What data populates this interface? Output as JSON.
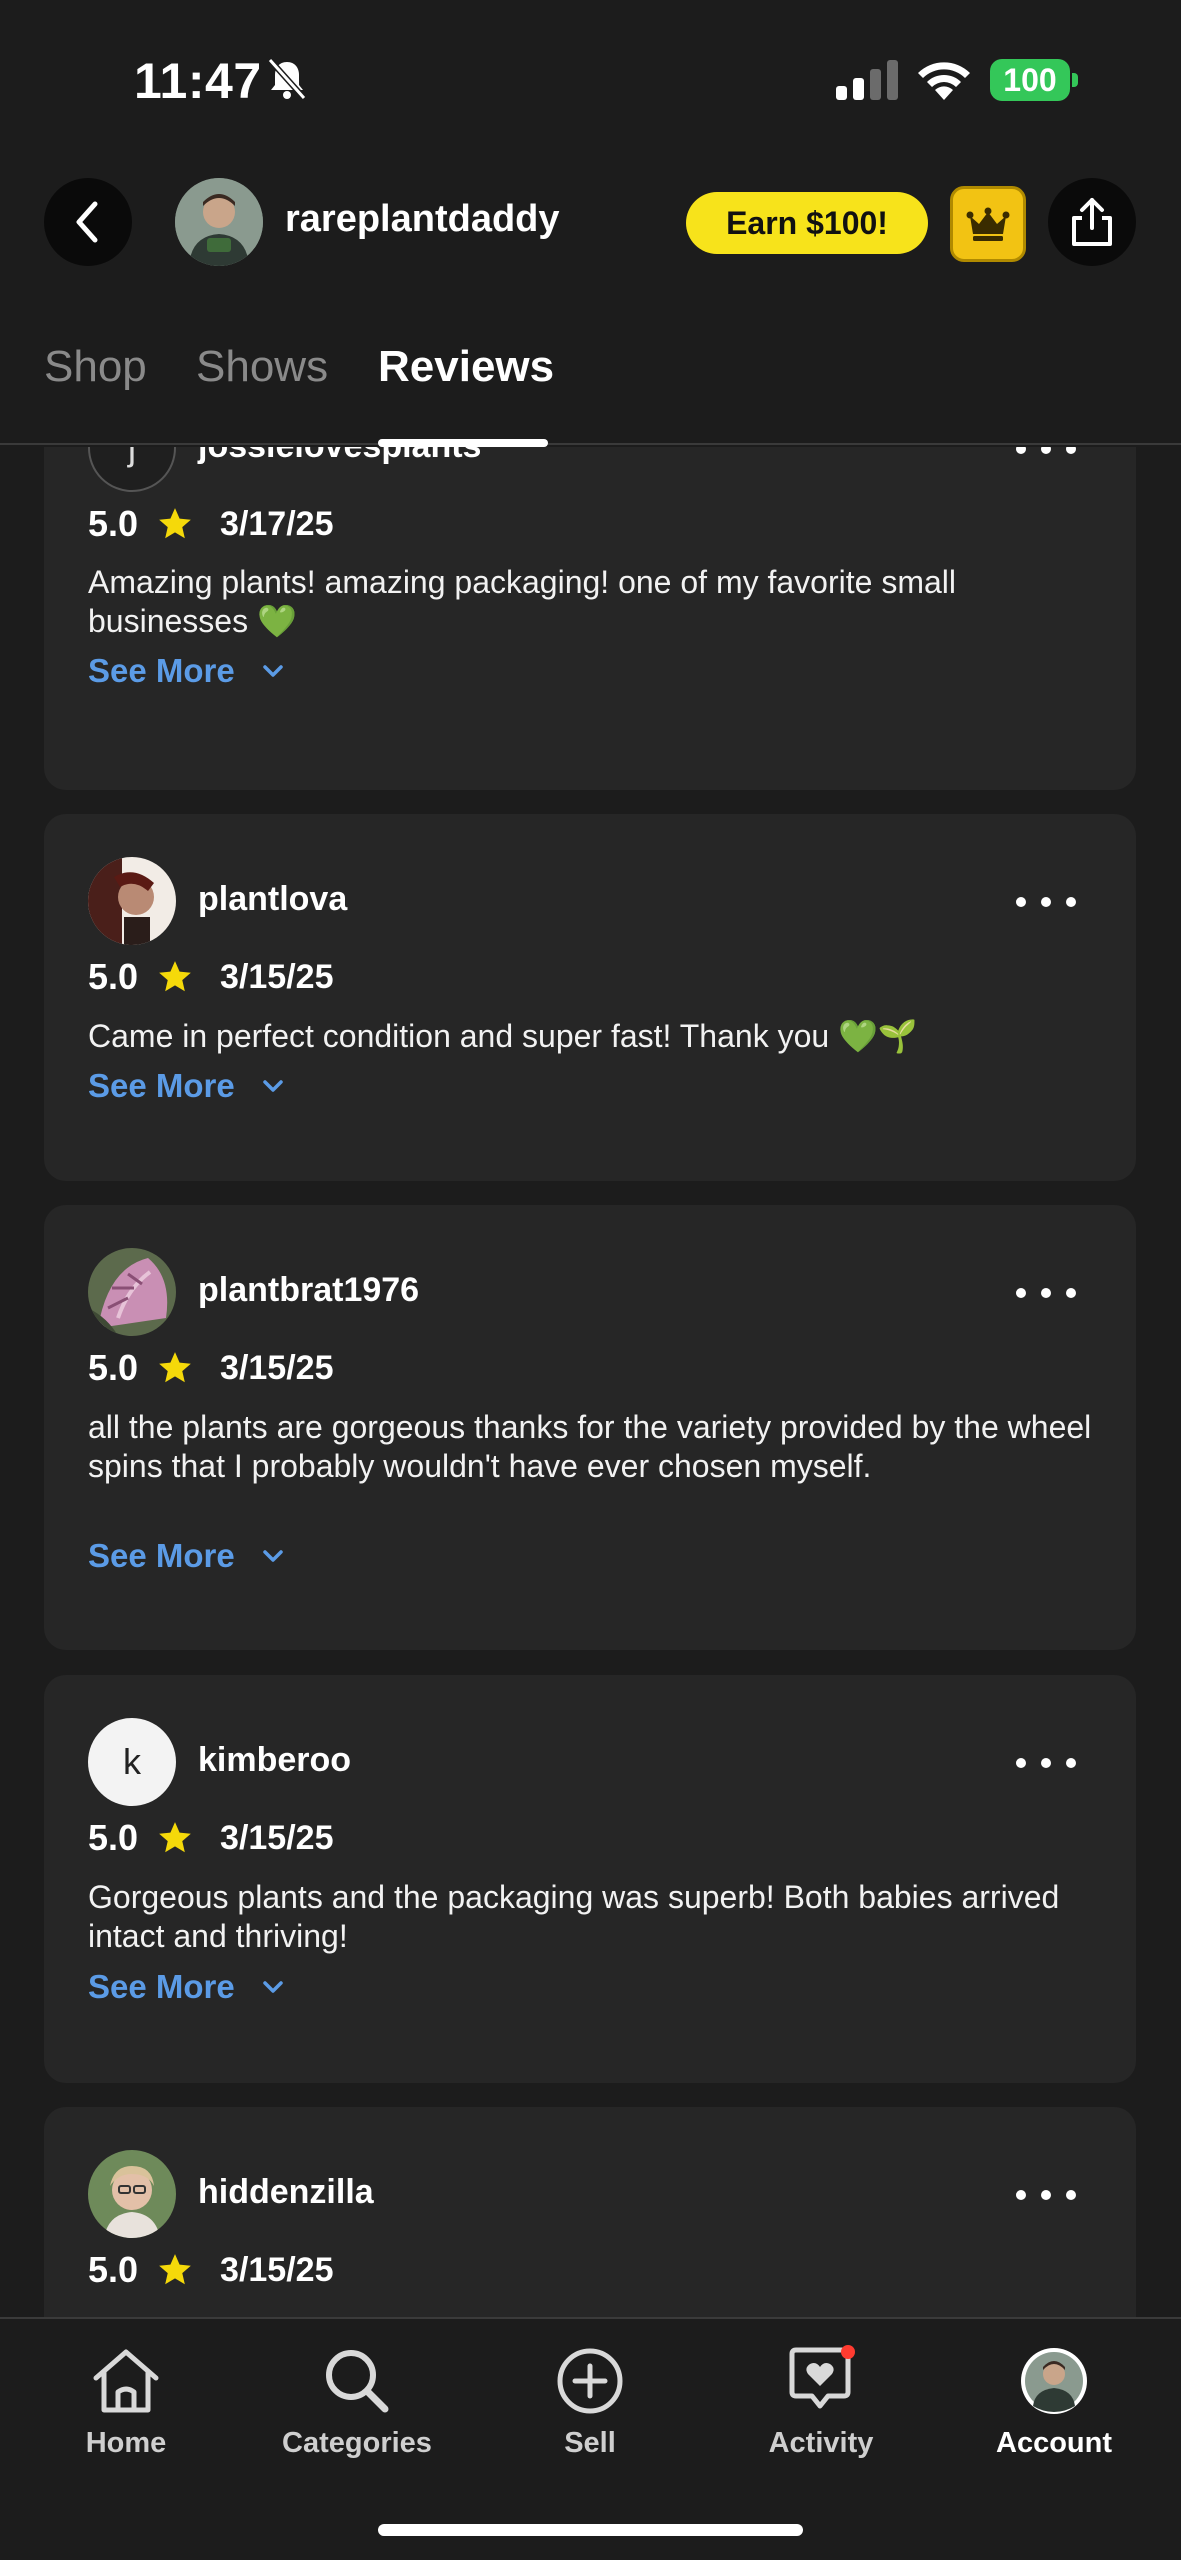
{
  "status_bar": {
    "time": "11:47",
    "battery": "100"
  },
  "header": {
    "profile_name": "rareplantdaddy",
    "earn_label": "Earn $100!"
  },
  "tabs": [
    {
      "label": "Shop",
      "active": false
    },
    {
      "label": "Shows",
      "active": false
    },
    {
      "label": "Reviews",
      "active": true
    }
  ],
  "reviews": [
    {
      "username": "jossielovesplants",
      "avatar_letter": "j",
      "rating": "5.0",
      "date": "3/17/25",
      "text": "Amazing plants! amazing packaging! one of my favorite small businesses 💚",
      "see_more": "See More"
    },
    {
      "username": "plantlova",
      "avatar_letter": "",
      "rating": "5.0",
      "date": "3/15/25",
      "text": "Came in perfect condition and super fast! Thank you 💚🌱",
      "see_more": "See More"
    },
    {
      "username": "plantbrat1976",
      "avatar_letter": "",
      "rating": "5.0",
      "date": "3/15/25",
      "text": "all the plants are gorgeous thanks for the variety provided by the wheel spins that I probably wouldn't have ever chosen myself.",
      "see_more": "See More"
    },
    {
      "username": "kimberoo",
      "avatar_letter": "k",
      "rating": "5.0",
      "date": "3/15/25",
      "text": "Gorgeous plants and the packaging was superb! Both babies arrived intact and thriving!",
      "see_more": "See More"
    },
    {
      "username": "hiddenzilla",
      "avatar_letter": "",
      "rating": "5.0",
      "date": "3/15/25",
      "text": "",
      "see_more": ""
    }
  ],
  "bottom_nav": [
    {
      "label": "Home",
      "icon": "home-icon"
    },
    {
      "label": "Categories",
      "icon": "search-icon"
    },
    {
      "label": "Sell",
      "icon": "plus-circle-icon"
    },
    {
      "label": "Activity",
      "icon": "heart-message-icon"
    },
    {
      "label": "Account",
      "icon": "avatar-icon",
      "active": true
    }
  ],
  "colors": {
    "background": "#1c1c1c",
    "card": "#262626",
    "link": "#5b9be6",
    "earn_button": "#f7e31b",
    "crown_button": "#f2c313",
    "battery": "#34c759",
    "star": "#f5d90a",
    "notification_dot": "#ff3b30"
  }
}
